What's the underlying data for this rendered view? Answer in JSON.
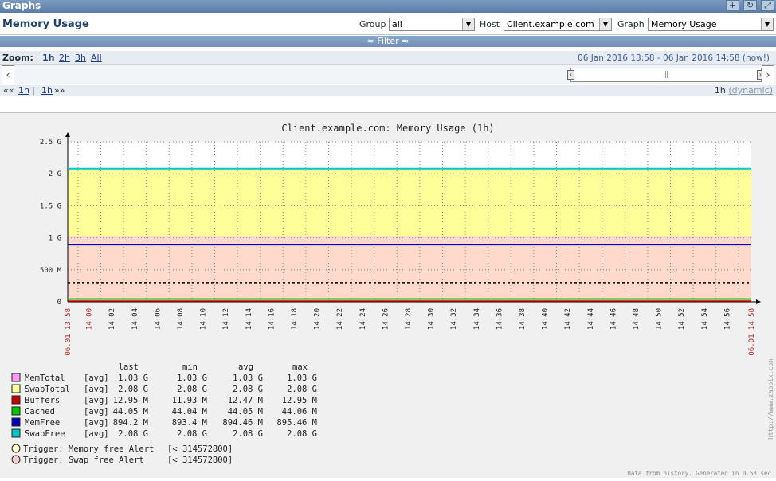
{
  "titlebar": {
    "title": "Graphs"
  },
  "header": {
    "page_title": "Memory Usage",
    "group_label": "Group",
    "group_value": "all",
    "host_label": "Host",
    "host_value": "Client.example.com",
    "graph_label": "Graph",
    "graph_value": "Memory Usage"
  },
  "filter": {
    "label": "≈ Filter ≈"
  },
  "zoom": {
    "label": "Zoom:",
    "options": [
      "1h",
      "2h",
      "3h",
      "All"
    ],
    "period": "06 Jan 2016 13:58  -  06 Jan 2016 14:58 (now!)"
  },
  "nav": {
    "prev_arrows": "««",
    "prev_link": "1h",
    "separator": "|",
    "next_link": "1h",
    "next_arrows": "»»",
    "period_value": "1h",
    "period_mode": "(dynamic)"
  },
  "colors": {
    "MemTotal": "#ff99ff",
    "SwapTotal": "#ffff99",
    "Buffers": "#c80000",
    "Cached": "#00c800",
    "MemFree": "#0000c8",
    "SwapFree": "#00c8c8",
    "triggerMem": "#ffffcc",
    "triggerSwap": "#ffcccc"
  },
  "chart_data": {
    "type": "line",
    "title": "Client.example.com: Memory Usage (1h)",
    "y_ticks": [
      {
        "v": 0,
        "label": "0"
      },
      {
        "v": 500,
        "label": "500 M"
      },
      {
        "v": 1000,
        "label": "1 G"
      },
      {
        "v": 1500,
        "label": "1.5 G"
      },
      {
        "v": 2000,
        "label": "2 G"
      },
      {
        "v": 2500,
        "label": "2.5 G"
      }
    ],
    "ylim": [
      0,
      2500
    ],
    "y_unit": "MB",
    "x_start_label": "06.01 13:58",
    "x_end_label": "06.01 14:58",
    "x_labels": [
      "14:00",
      "14:02",
      "14:04",
      "14:06",
      "14:08",
      "14:10",
      "14:12",
      "14:14",
      "14:16",
      "14:18",
      "14:20",
      "14:22",
      "14:24",
      "14:26",
      "14:28",
      "14:30",
      "14:32",
      "14:34",
      "14:36",
      "14:38",
      "14:40",
      "14:42",
      "14:44",
      "14:46",
      "14:48",
      "14:50",
      "14:52",
      "14:54",
      "14:56"
    ],
    "series": [
      {
        "name": "MemTotal",
        "value": 1030
      },
      {
        "name": "SwapTotal",
        "value": 2080
      },
      {
        "name": "Buffers",
        "value": 12.95
      },
      {
        "name": "Cached",
        "value": 44.05
      },
      {
        "name": "MemFree",
        "value": 894.2
      },
      {
        "name": "SwapFree",
        "value": 2080
      }
    ],
    "triggers": [
      {
        "name": "Memory free Alert",
        "value": 300
      }
    ],
    "legend": {
      "headers": [
        "last",
        "min",
        "avg",
        "max"
      ],
      "rows": [
        {
          "name": "MemTotal",
          "func": "[avg]",
          "last": "1.03 G",
          "min": "1.03 G",
          "avg": "1.03 G",
          "max": "1.03 G"
        },
        {
          "name": "SwapTotal",
          "func": "[avg]",
          "last": "2.08 G",
          "min": "2.08 G",
          "avg": "2.08 G",
          "max": "2.08 G"
        },
        {
          "name": "Buffers",
          "func": "[avg]",
          "last": "12.95 M",
          "min": "11.93 M",
          "avg": "12.47 M",
          "max": "12.95 M"
        },
        {
          "name": "Cached",
          "func": "[avg]",
          "last": "44.05 M",
          "min": "44.04 M",
          "avg": "44.05 M",
          "max": "44.06 M"
        },
        {
          "name": "MemFree",
          "func": "[avg]",
          "last": "894.2 M",
          "min": "893.4 M",
          "avg": "894.46 M",
          "max": "895.46 M"
        },
        {
          "name": "SwapFree",
          "func": "[avg]",
          "last": "2.08 G",
          "min": "2.08 G",
          "avg": "2.08 G",
          "max": "2.08 G"
        }
      ],
      "triggers": [
        {
          "label": "Trigger: Memory free Alert",
          "value": "[< 314572800]"
        },
        {
          "label": "Trigger: Swap free Alert",
          "value": "[< 314572800]"
        }
      ]
    },
    "watermark": "http://www.zabbix.com",
    "footer": "Data from history. Generated in 0.53 sec"
  }
}
